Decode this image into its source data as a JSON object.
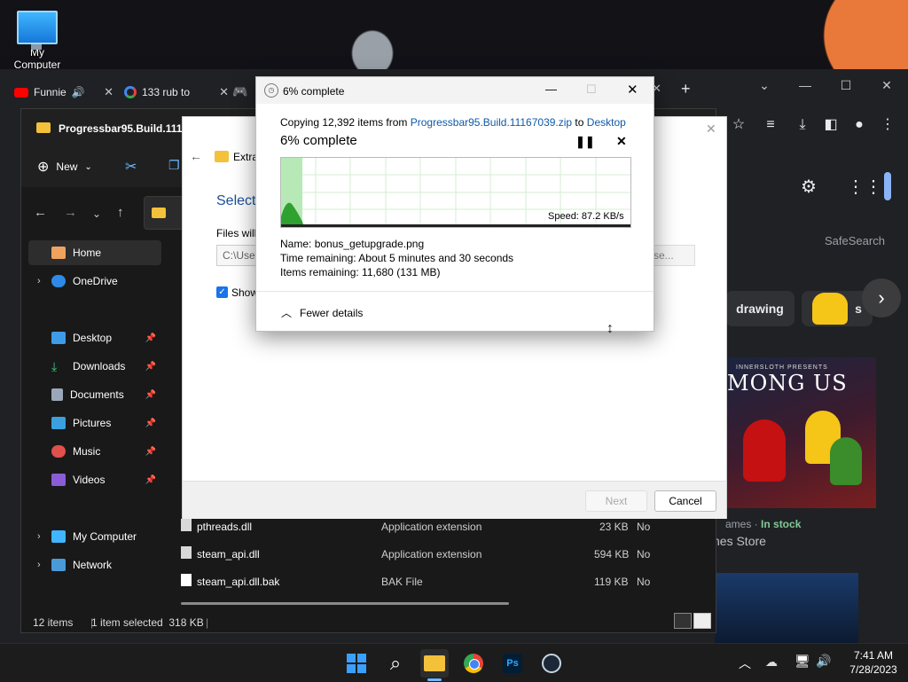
{
  "desktop": {
    "icon_label": "My Computer"
  },
  "browser": {
    "tabs": [
      {
        "label": "Funnie",
        "icon": "youtube-icon"
      },
      {
        "label": "133 rub to",
        "icon": "google-icon"
      }
    ],
    "safesearch": "SafeSearch",
    "chips": [
      "drawing",
      "s"
    ],
    "game_title": "MONG US",
    "game_banner": "INNERSLOTH PRESENTS",
    "stock_prefix": "ames · ",
    "stock_status": "In stock",
    "store": "nes Store"
  },
  "explorer": {
    "title": "Progressbar95.Build.11167",
    "new_label": "New",
    "sidebar": [
      {
        "label": "Home",
        "icon": "home-icon"
      },
      {
        "label": "OneDrive",
        "icon": "cloud-icon"
      },
      {
        "label": "Desktop",
        "icon": "desktop-icon"
      },
      {
        "label": "Downloads",
        "icon": "download-icon"
      },
      {
        "label": "Documents",
        "icon": "document-icon"
      },
      {
        "label": "Pictures",
        "icon": "picture-icon"
      },
      {
        "label": "Music",
        "icon": "music-icon"
      },
      {
        "label": "Videos",
        "icon": "video-icon"
      },
      {
        "label": "My Computer",
        "icon": "computer-icon"
      },
      {
        "label": "Network",
        "icon": "network-icon"
      }
    ],
    "files": [
      {
        "name": "pthreads.dll",
        "type": "Application extension",
        "size": "23 KB",
        "compressed": "No"
      },
      {
        "name": "steam_api.dll",
        "type": "Application extension",
        "size": "594 KB",
        "compressed": "No"
      },
      {
        "name": "steam_api.dll.bak",
        "type": "BAK File",
        "size": "119 KB",
        "compressed": "No"
      }
    ],
    "status": {
      "items": "12 items",
      "selected": "1 item selected  318 KB"
    }
  },
  "wizard": {
    "header": "Extra",
    "heading": "Select",
    "files_label": "Files will",
    "path_value": "C:\\User",
    "browse": "se...",
    "show_label": "Show",
    "next": "Next",
    "cancel": "Cancel"
  },
  "copy_dialog": {
    "title": "6% complete",
    "copying_prefix": "Copying 12,392 items from ",
    "source": "Progressbar95.Build.11167039.zip",
    "to": " to ",
    "destination": "Desktop",
    "percent_text": "6% complete",
    "progress_percent": 6,
    "speed": "Speed: 87.2 KB/s",
    "name_label": "Name:",
    "name_value": "bonus_getupgrade.png",
    "time_label": "Time remaining:",
    "time_value": "About 5 minutes and 30 seconds",
    "items_label": "Items remaining:",
    "items_value": "11,680 (131 MB)",
    "fewer_details": "Fewer details"
  },
  "taskbar": {
    "time": "7:41 AM",
    "date": "7/28/2023",
    "ps_label": "Ps"
  },
  "colors": {
    "accent": "#0f5aa8",
    "progress": "#7fd67f",
    "instock": "#81c995"
  }
}
